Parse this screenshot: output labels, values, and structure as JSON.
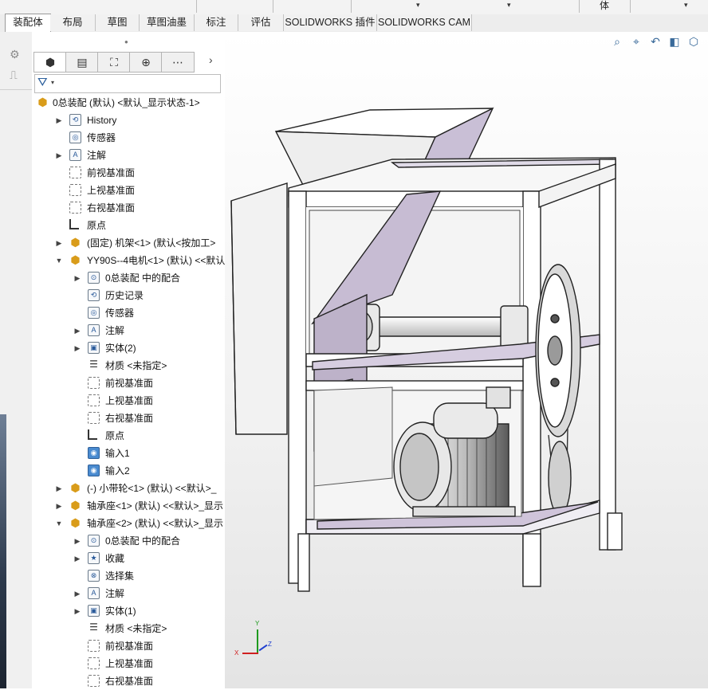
{
  "ribbon": {
    "top_items": [
      "…",
      "体"
    ],
    "tabs": [
      {
        "label": "装配体",
        "active": true
      },
      {
        "label": "布局",
        "active": false
      },
      {
        "label": "草图",
        "active": false
      },
      {
        "label": "草图油墨",
        "active": false
      },
      {
        "label": "标注",
        "active": false
      },
      {
        "label": "评估",
        "active": false
      },
      {
        "label": "SOLIDWORKS 插件",
        "active": false
      },
      {
        "label": "SOLIDWORKS CAM",
        "active": false
      }
    ]
  },
  "feature_tree": {
    "panel_tabs": [
      "feature-manager",
      "property-manager",
      "configuration-manager",
      "dimxpert-manager",
      "more"
    ],
    "items": [
      {
        "label": "0总装配 (默认) <默认_显示状态-1>",
        "depth": 0,
        "expander": "",
        "icon": "assembly-icon"
      },
      {
        "label": "History",
        "depth": 1,
        "expander": "▶",
        "icon": "history-icon"
      },
      {
        "label": "传感器",
        "depth": 1,
        "expander": "",
        "icon": "sensor-icon"
      },
      {
        "label": "注解",
        "depth": 1,
        "expander": "▶",
        "icon": "annotation-icon"
      },
      {
        "label": "前视基准面",
        "depth": 1,
        "expander": "",
        "icon": "plane-icon"
      },
      {
        "label": "上视基准面",
        "depth": 1,
        "expander": "",
        "icon": "plane-icon"
      },
      {
        "label": "右视基准面",
        "depth": 1,
        "expander": "",
        "icon": "plane-icon"
      },
      {
        "label": "原点",
        "depth": 1,
        "expander": "",
        "icon": "origin-icon"
      },
      {
        "label": "(固定) 机架<1> (默认<按加工>",
        "depth": 1,
        "expander": "▶",
        "icon": "assembly-icon"
      },
      {
        "label": "YY90S--4电机<1> (默认) <<默认",
        "depth": 1,
        "expander": "▼",
        "icon": "assembly-icon"
      },
      {
        "label": "0总装配 中的配合",
        "depth": 2,
        "expander": "▶",
        "icon": "mates-icon"
      },
      {
        "label": "历史记录",
        "depth": 2,
        "expander": "",
        "icon": "history-icon"
      },
      {
        "label": "传感器",
        "depth": 2,
        "expander": "",
        "icon": "sensor-icon"
      },
      {
        "label": "注解",
        "depth": 2,
        "expander": "▶",
        "icon": "annotation-icon"
      },
      {
        "label": "实体(2)",
        "depth": 2,
        "expander": "▶",
        "icon": "solid-bodies-icon"
      },
      {
        "label": "材质 <未指定>",
        "depth": 2,
        "expander": "",
        "icon": "material-icon"
      },
      {
        "label": "前视基准面",
        "depth": 2,
        "expander": "",
        "icon": "plane-icon"
      },
      {
        "label": "上视基准面",
        "depth": 2,
        "expander": "",
        "icon": "plane-icon"
      },
      {
        "label": "右视基准面",
        "depth": 2,
        "expander": "",
        "icon": "plane-icon"
      },
      {
        "label": "原点",
        "depth": 2,
        "expander": "",
        "icon": "origin-icon"
      },
      {
        "label": "输入1",
        "depth": 2,
        "expander": "",
        "icon": "imported-body-icon"
      },
      {
        "label": "输入2",
        "depth": 2,
        "expander": "",
        "icon": "imported-body-icon"
      },
      {
        "label": "(-) 小带轮<1> (默认) <<默认>_",
        "depth": 1,
        "expander": "▶",
        "icon": "assembly-icon"
      },
      {
        "label": "轴承座<1> (默认) <<默认>_显示",
        "depth": 1,
        "expander": "▶",
        "icon": "assembly-icon"
      },
      {
        "label": "轴承座<2> (默认) <<默认>_显示",
        "depth": 1,
        "expander": "▼",
        "icon": "assembly-icon"
      },
      {
        "label": "0总装配 中的配合",
        "depth": 2,
        "expander": "▶",
        "icon": "mates-icon"
      },
      {
        "label": "收藏",
        "depth": 2,
        "expander": "▶",
        "icon": "favorites-icon"
      },
      {
        "label": "选择集",
        "depth": 2,
        "expander": "",
        "icon": "selection-set-icon"
      },
      {
        "label": "注解",
        "depth": 2,
        "expander": "▶",
        "icon": "annotation-icon"
      },
      {
        "label": "实体(1)",
        "depth": 2,
        "expander": "▶",
        "icon": "solid-bodies-icon"
      },
      {
        "label": "材质 <未指定>",
        "depth": 2,
        "expander": "",
        "icon": "material-icon"
      },
      {
        "label": "前视基准面",
        "depth": 2,
        "expander": "",
        "icon": "plane-icon"
      },
      {
        "label": "上视基准面",
        "depth": 2,
        "expander": "",
        "icon": "plane-icon"
      },
      {
        "label": "右视基准面",
        "depth": 2,
        "expander": "",
        "icon": "plane-icon"
      }
    ]
  },
  "viewport": {
    "heads_up_tools": [
      "zoom-to-fit-icon",
      "zoom-area-icon",
      "previous-view-icon",
      "section-view-icon",
      "view-orientation-icon"
    ],
    "triad": {
      "x": "X",
      "y": "Y",
      "z": "Z"
    }
  }
}
